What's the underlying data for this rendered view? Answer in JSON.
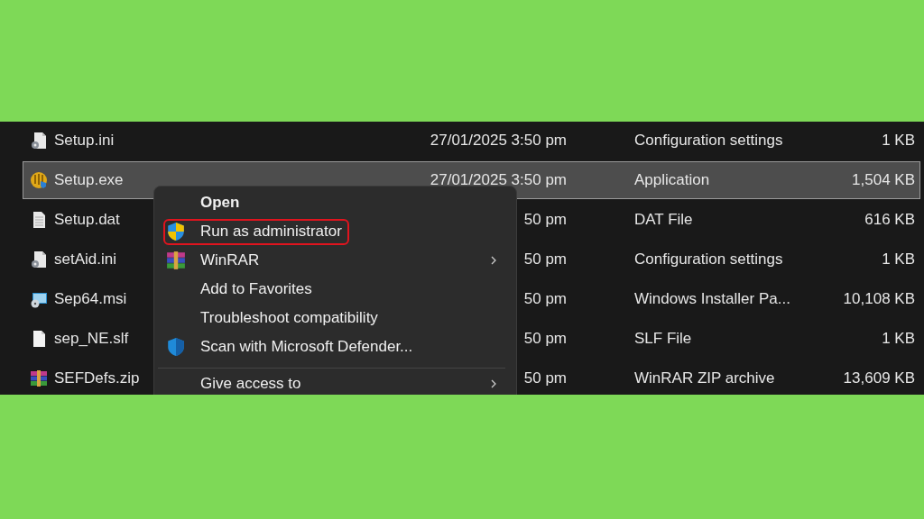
{
  "files": [
    {
      "name": "Setup.ini",
      "kind": "settings-file",
      "date": "27/01/2025 3:50 pm",
      "type": "Configuration settings",
      "size": "1 KB",
      "selected": false
    },
    {
      "name": "Setup.exe",
      "kind": "installer",
      "date": "27/01/2025 3:50 pm",
      "type": "Application",
      "size": "1,504 KB",
      "selected": true
    },
    {
      "name": "Setup.dat",
      "kind": "text-file",
      "date": "50 pm",
      "type": "DAT File",
      "size": "616 KB",
      "selected": false
    },
    {
      "name": "setAid.ini",
      "kind": "settings-file",
      "date": "50 pm",
      "type": "Configuration settings",
      "size": "1 KB",
      "selected": false
    },
    {
      "name": "Sep64.msi",
      "kind": "msi",
      "date": "50 pm",
      "type": "Windows Installer Pa...",
      "size": "10,108 KB",
      "selected": false
    },
    {
      "name": "sep_NE.slf",
      "kind": "blank-file",
      "date": "50 pm",
      "type": "SLF File",
      "size": "1 KB",
      "selected": false
    },
    {
      "name": "SEFDefs.zip",
      "kind": "archive",
      "date": "50 pm",
      "type": "WinRAR ZIP archive",
      "size": "13,609 KB",
      "selected": false
    }
  ],
  "context_menu": {
    "items": [
      {
        "kind": "plain",
        "label": "Open",
        "default": true,
        "outlined": false,
        "submenu": false
      },
      {
        "kind": "shield",
        "label": "Run as administrator",
        "default": false,
        "outlined": true,
        "submenu": false
      },
      {
        "kind": "archive",
        "label": "WinRAR",
        "default": false,
        "outlined": false,
        "submenu": true
      },
      {
        "kind": "plain",
        "label": "Add to Favorites",
        "default": false,
        "outlined": false,
        "submenu": false
      },
      {
        "kind": "plain",
        "label": "Troubleshoot compatibility",
        "default": false,
        "outlined": false,
        "submenu": false
      },
      {
        "kind": "defender",
        "label": "Scan with Microsoft Defender...",
        "default": false,
        "outlined": false,
        "submenu": false
      },
      {
        "kind": "separator"
      },
      {
        "kind": "plain",
        "label": "Give access to",
        "default": false,
        "outlined": false,
        "submenu": true
      }
    ]
  }
}
